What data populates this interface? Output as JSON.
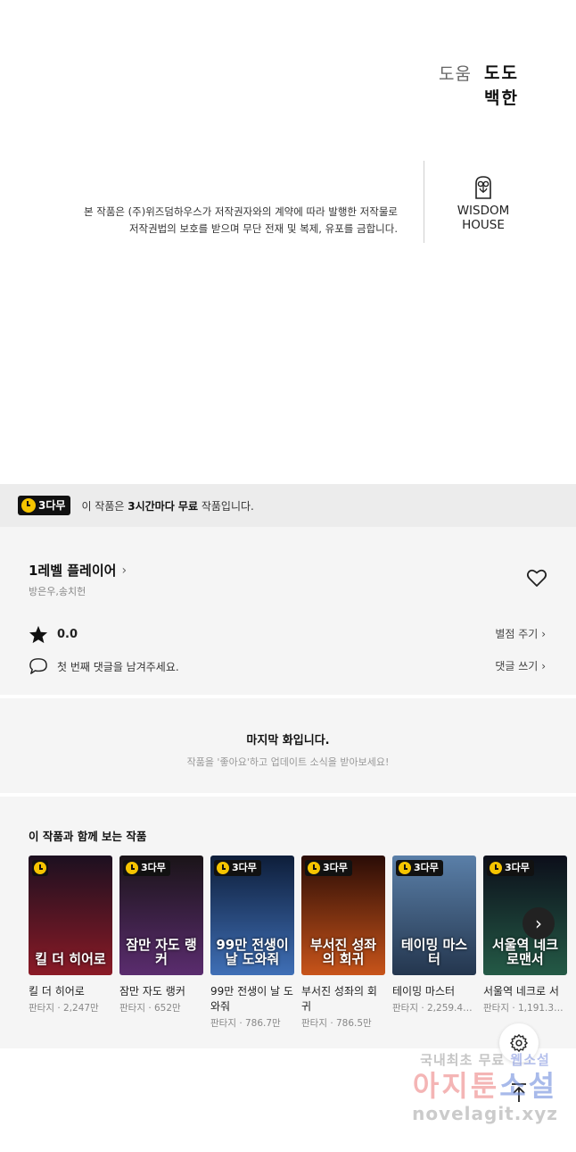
{
  "credits": {
    "role": "도움",
    "names": [
      "도도",
      "백한"
    ]
  },
  "copyright": {
    "line1": "본 작품은 (주)위즈덤하우스가 저작권자와의 계약에 따라 발행한 저작물로",
    "line2": "저작권법의 보호를 받으며 무단 전재 및 복제, 유포를 금합니다.",
    "logo_text": "WISDOM HOUSE"
  },
  "free_banner": {
    "badge": "3다무",
    "text_before": "이 작품은 ",
    "text_bold": "3시간마다 무료",
    "text_after": " 작품입니다."
  },
  "work": {
    "title": "1레벨 플레이어",
    "authors": "방은우,송치헌",
    "rating": "0.0",
    "rate_link": "별점 주기",
    "comment_prompt": "첫 번째 댓글을 남겨주세요.",
    "comment_link": "댓글 쓰기"
  },
  "last_episode": {
    "title": "마지막 화입니다.",
    "subtitle": "작품을 '좋아요'하고 업데이트 소식을 받아보세요!"
  },
  "recommendations": {
    "heading": "이 작품과 함께 보는 작품",
    "items": [
      {
        "name": "킬 더 히어로",
        "genre": "판타지",
        "views": "2,247만",
        "badge": "",
        "cover_title": "킬 더 히어로",
        "color_top": "#1c1020",
        "color_bottom": "#8a1a26"
      },
      {
        "name": "잠만 자도 랭커",
        "genre": "판타지",
        "views": "652만",
        "badge": "3다무",
        "cover_title": "잠만 자도 랭커",
        "color_top": "#1a1418",
        "color_bottom": "#5a2c6e"
      },
      {
        "name": "99만 전생이 날 도와줘",
        "genre": "판타지",
        "views": "786.7만",
        "badge": "3다무",
        "cover_title": "99만 전생이 날 도와줘",
        "color_top": "#0e1e3a",
        "color_bottom": "#3f6fb6"
      },
      {
        "name": "부서진 성좌의 회귀",
        "genre": "판타지",
        "views": "786.5만",
        "badge": "3다무",
        "cover_title": "부서진 성좌의 회귀",
        "color_top": "#2a0c06",
        "color_bottom": "#c8541a"
      },
      {
        "name": "테이밍 마스터",
        "genre": "판타지",
        "views": "2,259.4…",
        "badge": "3다무",
        "cover_title": "테이밍 마스터",
        "color_top": "#5a7fa8",
        "color_bottom": "#24364e"
      },
      {
        "name": "서울역 네크로 서",
        "genre": "판타지",
        "views": "1,191.3…",
        "badge": "3다무",
        "cover_title": "서울역 네크로맨서",
        "color_top": "#0c0e1a",
        "color_bottom": "#245a46"
      }
    ]
  },
  "watermark": {
    "line1_a": "국내최초 무료 ",
    "line1_b": "웹소설",
    "line2_a": "아지툰",
    "line2_b": "소설",
    "line3": "novelagit.xyz"
  }
}
